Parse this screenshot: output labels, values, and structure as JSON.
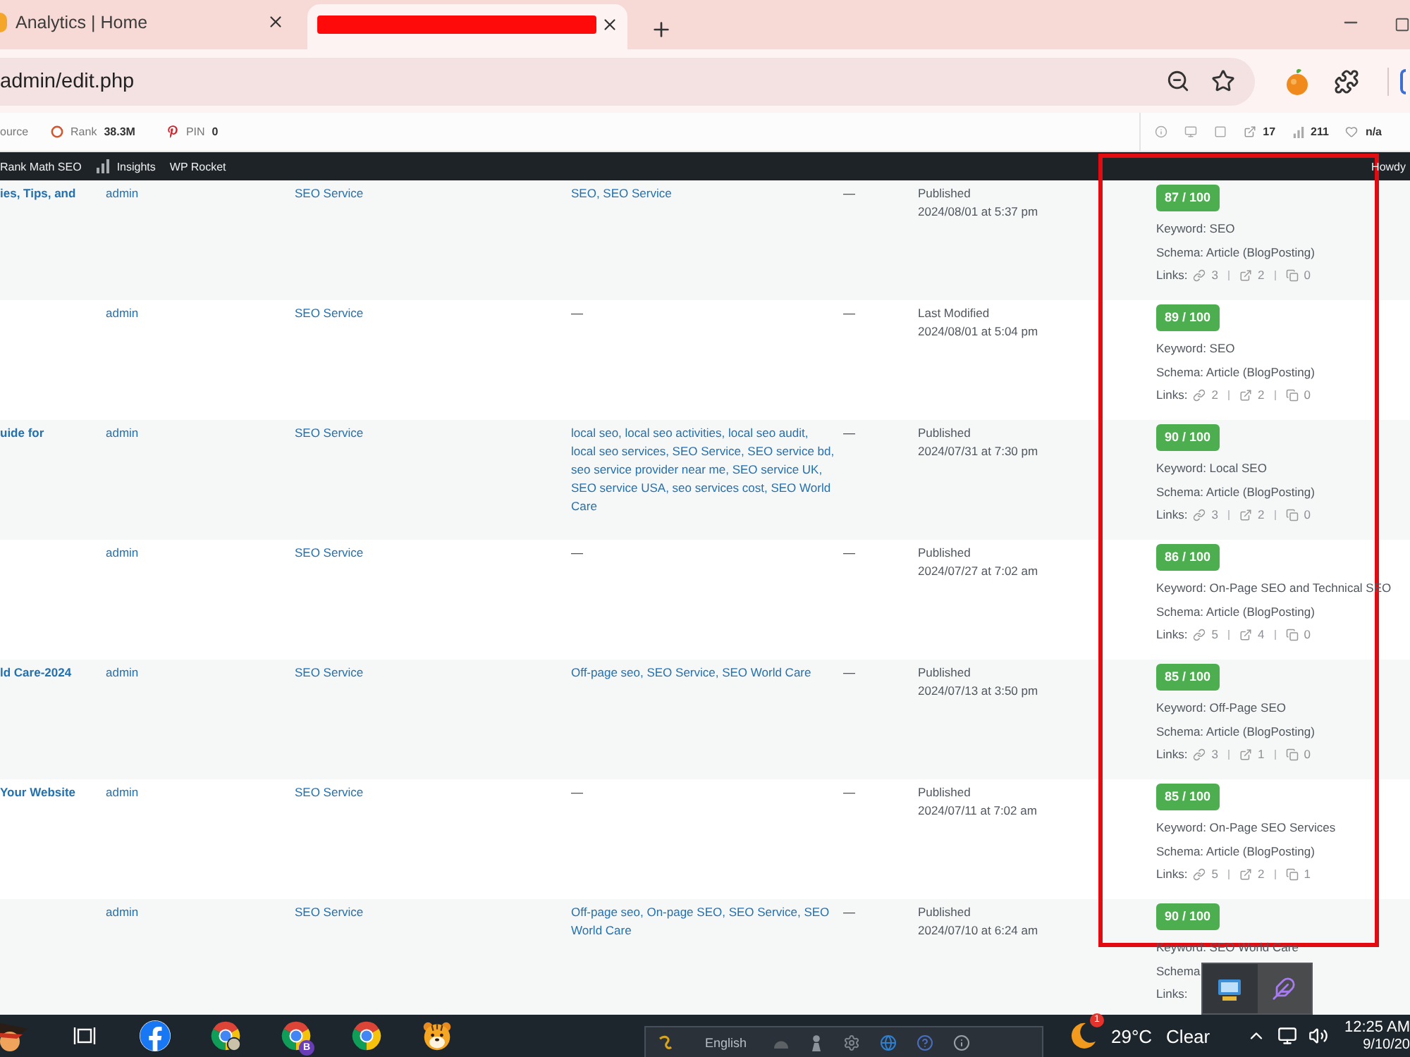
{
  "browser": {
    "tabs": [
      {
        "title": "Analytics | Home",
        "selected": false,
        "redacted": false
      },
      {
        "selected": true,
        "redacted": true
      }
    ],
    "address": {
      "url": "admin/edit.php"
    }
  },
  "seo_toolbar": {
    "left": [
      {
        "kind": "text",
        "label": "ource"
      },
      {
        "kind": "rank",
        "label": "Rank",
        "value": "38.3M"
      },
      {
        "kind": "pin",
        "label": "PIN",
        "value": "0"
      }
    ],
    "right": [
      {
        "kind": "external",
        "value": "17"
      },
      {
        "kind": "chart",
        "value": "211"
      },
      {
        "kind": "heart",
        "value": "n/a"
      }
    ]
  },
  "admin_bar": {
    "items": [
      {
        "kind": "text",
        "label": "Rank Math SEO"
      },
      {
        "kind": "chart",
        "label": "Insights"
      },
      {
        "kind": "text",
        "label": "WP Rocket"
      }
    ],
    "greeting": "Howdy"
  },
  "table": {
    "rows": [
      {
        "column_1": "ies, Tips, and",
        "column_2": "admin",
        "column_3": "SEO Service",
        "column_4": {
          "text": "SEO, SEO Service",
          "link": true
        },
        "column_5": "—",
        "column_6": [
          "Published",
          "2024/08/01 at 5:37 pm"
        ],
        "column_7": {
          "score": "87 / 100",
          "keyword": "Keyword: SEO",
          "schema": "Schema: Article (BlogPosting)",
          "links_label": "Links:",
          "links": [
            {
              "kind": "internal",
              "count": "3"
            },
            {
              "kind": "external",
              "count": "2"
            },
            {
              "kind": "incoming",
              "count": "0"
            }
          ]
        }
      },
      {
        "column_2": "admin",
        "column_3": "SEO Service",
        "column_4": {
          "text": "—",
          "link": false
        },
        "column_5": "—",
        "column_6": [
          "Last Modified",
          "2024/08/01 at 5:04 pm"
        ],
        "column_7": {
          "score": "89 / 100",
          "keyword": "Keyword: SEO",
          "schema": "Schema: Article (BlogPosting)",
          "links_label": "Links:",
          "links": [
            {
              "kind": "internal",
              "count": "2"
            },
            {
              "kind": "external",
              "count": "2"
            },
            {
              "kind": "incoming",
              "count": "0"
            }
          ]
        }
      },
      {
        "column_1": "uide for",
        "column_2": "admin",
        "column_3": "SEO Service",
        "column_4": {
          "text": "local seo, local seo activities, local seo audit, local seo services, SEO Service, SEO service bd, seo service provider near me, SEO service UK, SEO service USA, seo services cost, SEO World Care",
          "link": true
        },
        "column_5": "—",
        "column_6": [
          "Published",
          "2024/07/31 at 7:30 pm"
        ],
        "column_7": {
          "score": "90 / 100",
          "keyword": "Keyword: Local SEO",
          "schema": "Schema: Article (BlogPosting)",
          "links_label": "Links:",
          "links": [
            {
              "kind": "internal",
              "count": "3"
            },
            {
              "kind": "external",
              "count": "2"
            },
            {
              "kind": "incoming",
              "count": "0"
            }
          ]
        }
      },
      {
        "column_2": "admin",
        "column_3": "SEO Service",
        "column_4": {
          "text": "—",
          "link": false
        },
        "column_5": "—",
        "column_6": [
          "Published",
          "2024/07/27 at 7:02 am"
        ],
        "column_7": {
          "score": "86 / 100",
          "keyword": "Keyword: On-Page SEO and Technical SEO",
          "schema": "Schema: Article (BlogPosting)",
          "links_label": "Links:",
          "links": [
            {
              "kind": "internal",
              "count": "5"
            },
            {
              "kind": "external",
              "count": "4"
            },
            {
              "kind": "incoming",
              "count": "0"
            }
          ]
        }
      },
      {
        "column_1": "ld Care-2024",
        "column_2": "admin",
        "column_3": "SEO Service",
        "column_4": {
          "text": "Off-page seo, SEO Service, SEO World Care",
          "link": true
        },
        "column_5": "—",
        "column_6": [
          "Published",
          "2024/07/13 at 3:50 pm"
        ],
        "column_7": {
          "score": "85 / 100",
          "keyword": "Keyword: Off-Page SEO",
          "schema": "Schema: Article (BlogPosting)",
          "links_label": "Links:",
          "links": [
            {
              "kind": "internal",
              "count": "3"
            },
            {
              "kind": "external",
              "count": "1"
            },
            {
              "kind": "incoming",
              "count": "0"
            }
          ]
        }
      },
      {
        "column_1": "Your Website",
        "column_2": "admin",
        "column_3": "SEO Service",
        "column_4": {
          "text": "—",
          "link": false
        },
        "column_5": "—",
        "column_6": [
          "Published",
          "2024/07/11 at 7:02 am"
        ],
        "column_7": {
          "score": "85 / 100",
          "keyword": "Keyword: On-Page SEO Services",
          "schema": "Schema: Article (BlogPosting)",
          "links_label": "Links:",
          "links": [
            {
              "kind": "internal",
              "count": "5"
            },
            {
              "kind": "external",
              "count": "2"
            },
            {
              "kind": "incoming",
              "count": "1"
            }
          ]
        }
      },
      {
        "column_2": "admin",
        "column_3": "SEO Service",
        "column_4": {
          "text": "Off-page seo, On-page SEO, SEO Service, SEO World Care",
          "link": true
        },
        "column_5": "—",
        "column_6": [
          "Published",
          "2024/07/10 at 6:24 am"
        ],
        "column_7": {
          "score": "90 / 100",
          "keyword": "Keyword: SEO World Care",
          "schema": "Schema",
          "links_label": "Links:"
        }
      }
    ]
  },
  "taskbar": {
    "apps": [
      {
        "kind": "character"
      },
      {
        "kind": "task_view"
      },
      {
        "kind": "facebook"
      },
      {
        "kind": "chrome_photo"
      },
      {
        "kind": "chrome_letter",
        "letter": "B"
      },
      {
        "kind": "chrome"
      },
      {
        "kind": "tiger"
      }
    ],
    "language_bar": {
      "label": "English"
    },
    "weather": {
      "badge": "1",
      "temperature": "29°C",
      "condition": "Clear"
    },
    "clock": {
      "time": "12:25 AM",
      "date": "9/10/20"
    }
  }
}
